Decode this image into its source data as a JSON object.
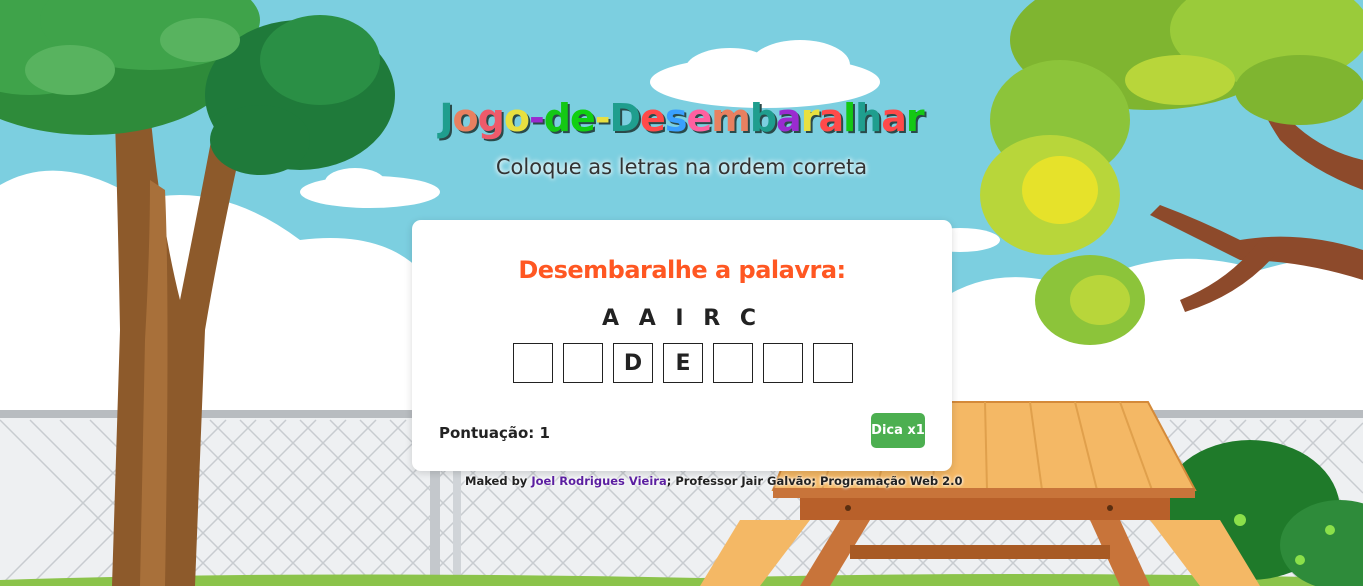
{
  "title": {
    "letters": [
      {
        "ch": "J",
        "color": "#1f9e8e"
      },
      {
        "ch": "o",
        "color": "#e88060"
      },
      {
        "ch": "g",
        "color": "#ee5a6a"
      },
      {
        "ch": "o",
        "color": "#e8e040"
      },
      {
        "ch": "-",
        "color": "#9a2bd0"
      },
      {
        "ch": "d",
        "color": "#14c814"
      },
      {
        "ch": "e",
        "color": "#10d010"
      },
      {
        "ch": "-",
        "color": "#e8e040"
      },
      {
        "ch": "D",
        "color": "#1f9e8e"
      },
      {
        "ch": "e",
        "color": "#ff4a4a"
      },
      {
        "ch": "s",
        "color": "#3aa0ff"
      },
      {
        "ch": "e",
        "color": "#ff60a0"
      },
      {
        "ch": "m",
        "color": "#e88060"
      },
      {
        "ch": "b",
        "color": "#1f9e8e"
      },
      {
        "ch": "a",
        "color": "#9a2bd0"
      },
      {
        "ch": "r",
        "color": "#e8e040"
      },
      {
        "ch": "a",
        "color": "#ff4a4a"
      },
      {
        "ch": "l",
        "color": "#14c814"
      },
      {
        "ch": "h",
        "color": "#1f9e8e"
      },
      {
        "ch": "a",
        "color": "#ff4a4a"
      },
      {
        "ch": "r",
        "color": "#14c814"
      }
    ]
  },
  "subtitle": "Coloque as letras na ordem correta",
  "card": {
    "heading": "Desembaralhe a palavra:",
    "scrambled": "A A I R C",
    "boxes": [
      "",
      "",
      "D",
      "E",
      "",
      "",
      ""
    ],
    "score": "Pontuação: 1",
    "hint_button": "Dica x1"
  },
  "footer": {
    "prefix": "Maked by ",
    "author": "Joel Rodrigues Vieira",
    "suffix": "; Professor Jair Galvão; Programação Web 2.0"
  },
  "colors": {
    "sky": "#7ccfe0",
    "accent": "#ff5722",
    "button": "#4caf50",
    "link": "#5b1fa0"
  }
}
